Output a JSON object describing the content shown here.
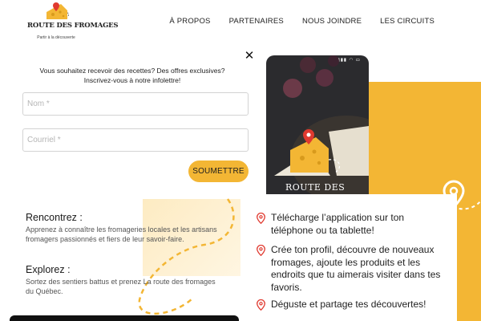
{
  "header": {
    "logo": {
      "brand": "ROUTE DES FROMAGES",
      "tagline": "Partir à la découverte"
    },
    "nav": [
      "À PROPOS",
      "PARTENAIRES",
      "NOUS JOINDRE",
      "LES CIRCUITS"
    ]
  },
  "popup": {
    "message_line1": "Vous souhaitez recevoir des recettes? Des offres exclusives?",
    "message_line2": "Inscrivez-vous à notre infolettre!",
    "name_placeholder": "Nom *",
    "email_placeholder": "Courriel *",
    "submit_label": "SOUMETTRE",
    "close_glyph": "✕"
  },
  "info": {
    "rencontrez_title": "Rencontrez :",
    "rencontrez_text": "Apprenez à connaître les fromageries locales et les artisans fromagers passionnés et fiers de leur savoir-faire.",
    "explorez_title": "Explorez :",
    "explorez_text": "Sortez des sentiers battus et prenez La route des fromages du Québec."
  },
  "phone": {
    "app_name": "ROUTE DES"
  },
  "features": [
    "Télécharge l’application sur ton téléphone ou ta tablette!",
    "Crée ton profil, découvre de nouveaux fromages, ajoute les produits et les endroits que tu aimerais visiter dans tes favoris.",
    "Déguste et partage tes découvertes!"
  ],
  "colors": {
    "accent": "#f3b634",
    "pin": "#e0392f",
    "dark": "#2b2b2e"
  },
  "icons": {
    "pin": "map-pin-icon",
    "close": "close-icon",
    "logo": "cheese-logo-icon"
  }
}
